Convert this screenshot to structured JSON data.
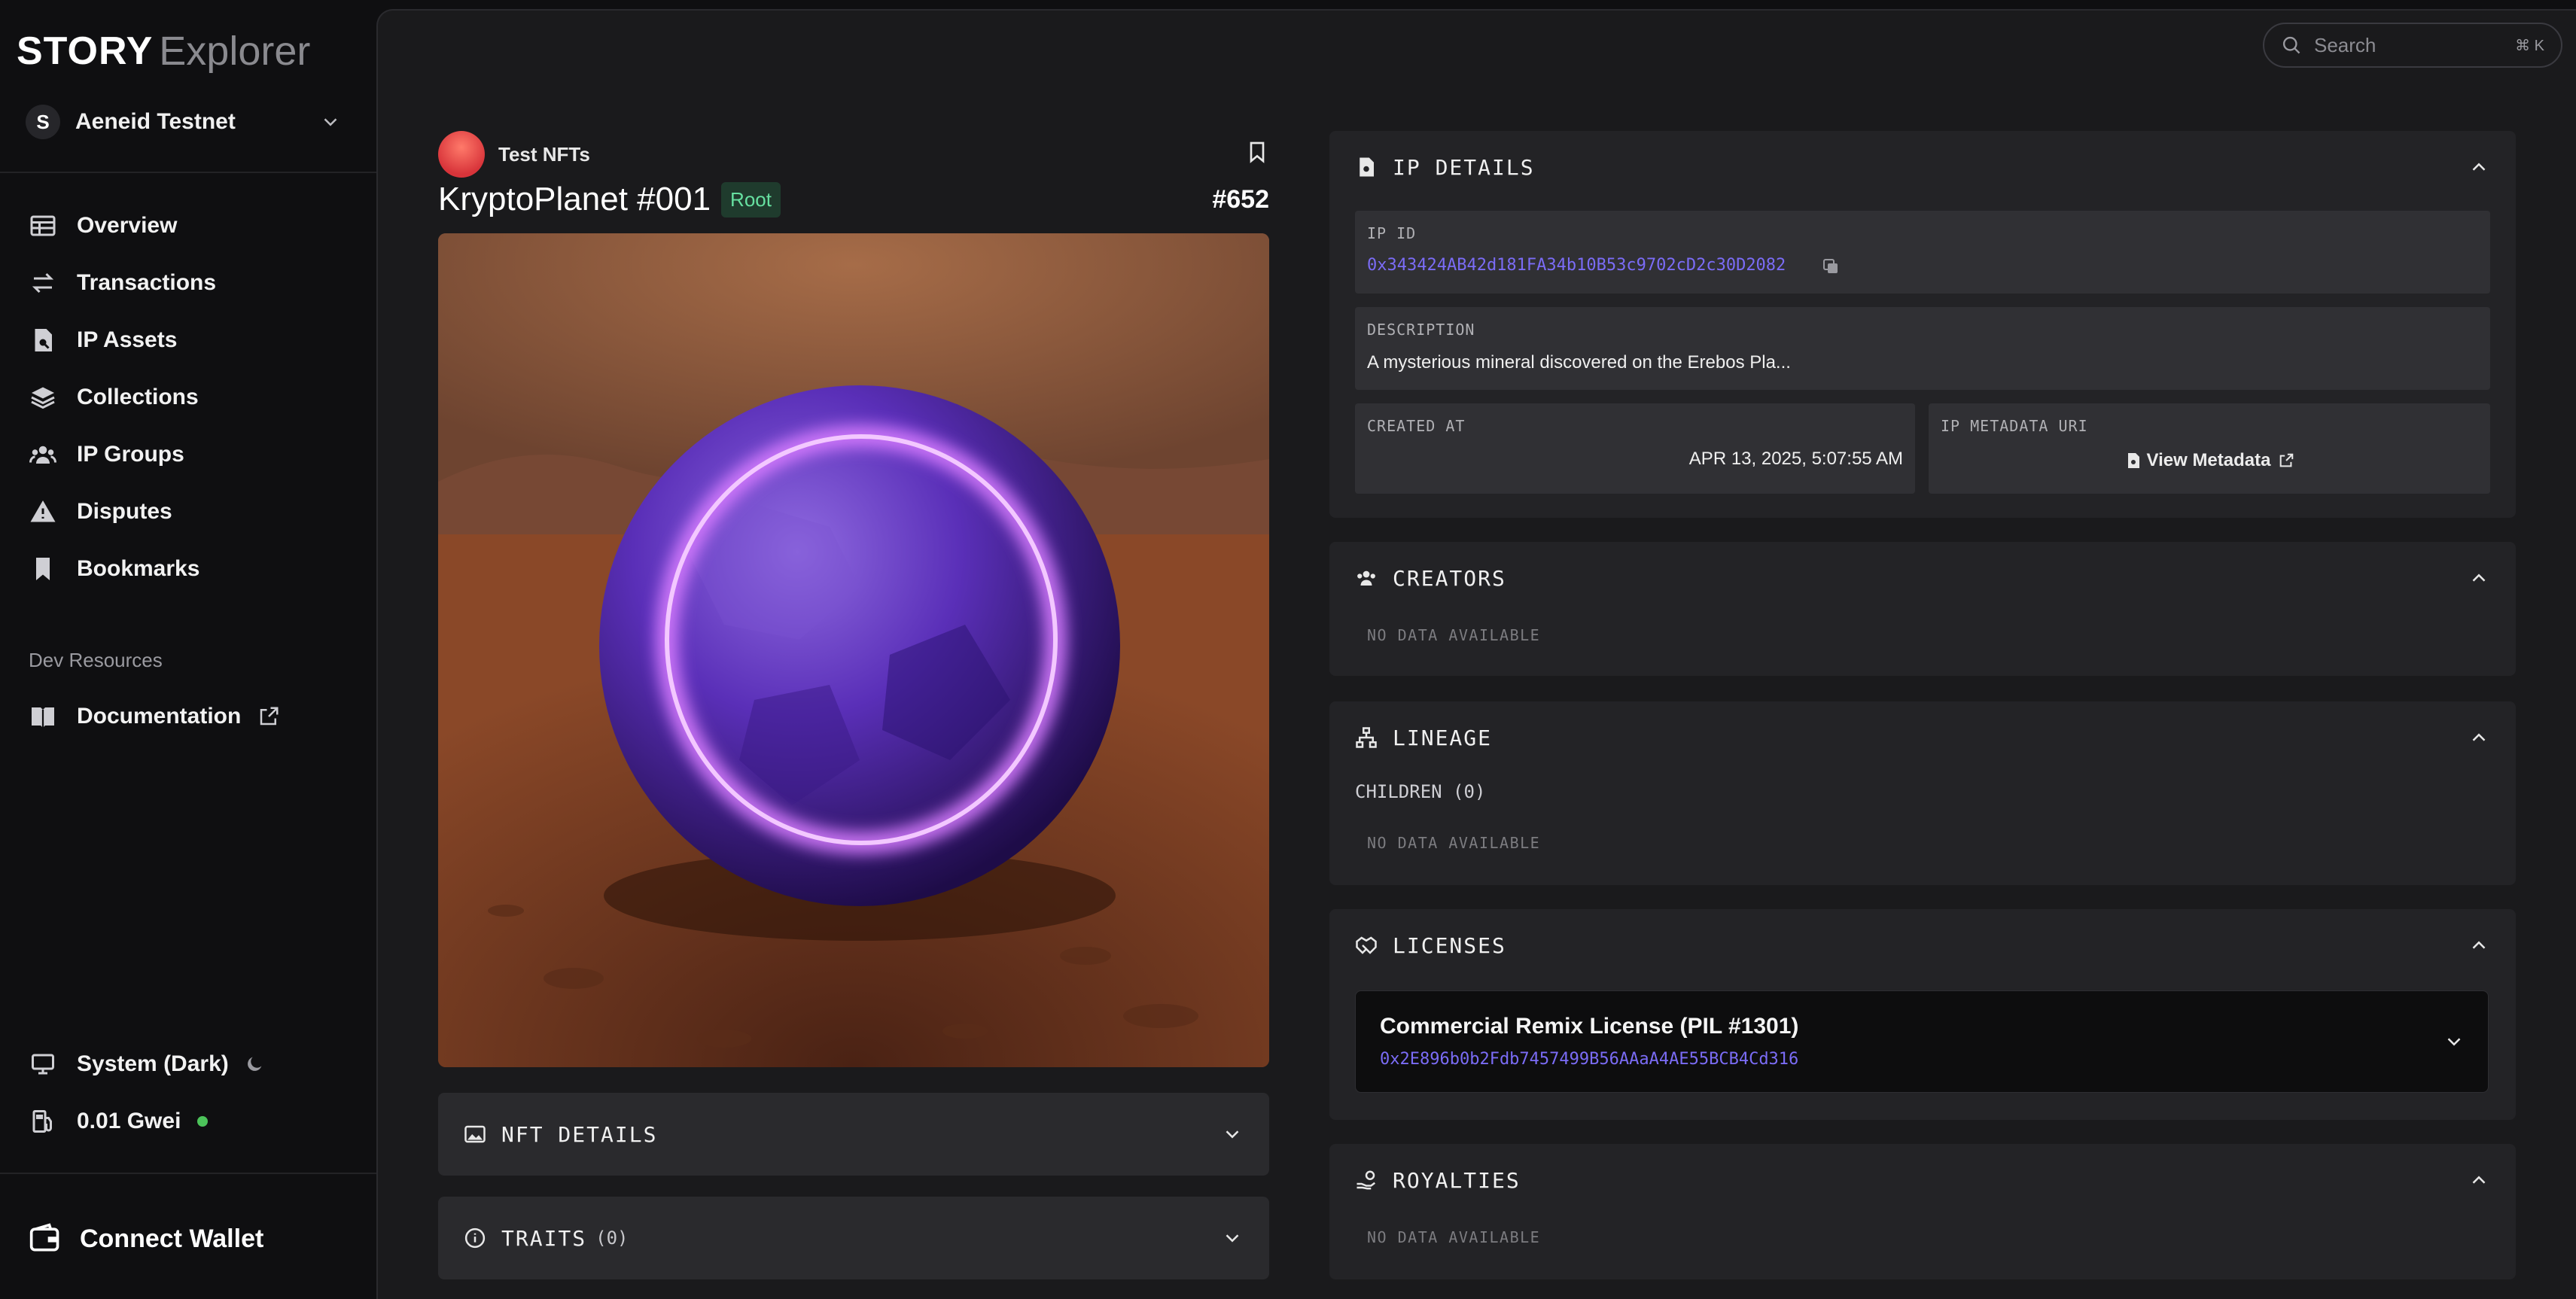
{
  "app": {
    "brand": "STORY",
    "product": "Explorer"
  },
  "network": {
    "badge": "S",
    "name": "Aeneid Testnet"
  },
  "sidebar": {
    "items": [
      {
        "label": "Overview",
        "icon": "table-icon"
      },
      {
        "label": "Transactions",
        "icon": "arrows-icon"
      },
      {
        "label": "IP Assets",
        "icon": "file-search-icon"
      },
      {
        "label": "Collections",
        "icon": "layers-icon"
      },
      {
        "label": "IP Groups",
        "icon": "users-icon"
      },
      {
        "label": "Disputes",
        "icon": "warning-icon"
      },
      {
        "label": "Bookmarks",
        "icon": "bookmark-icon"
      }
    ],
    "dev_section": "Dev Resources",
    "documentation": "Documentation",
    "theme": "System (Dark)",
    "gas": "0.01 Gwei",
    "connect_wallet": "Connect Wallet"
  },
  "search": {
    "placeholder": "Search",
    "shortcut": "⌘ K"
  },
  "asset": {
    "collection": "Test NFTs",
    "title": "KryptoPlanet #001",
    "badge": "Root",
    "token_number": "#652"
  },
  "left_sections": {
    "nft_details": "NFT DETAILS",
    "traits": "TRAITS",
    "traits_count": "(0)"
  },
  "ip_details": {
    "heading": "IP DETAILS",
    "ip_id_label": "IP ID",
    "ip_id": "0x343424AB42d181FA34b10B53c9702cD2c30D2082",
    "description_label": "DESCRIPTION",
    "description": "A mysterious mineral discovered on the Erebos Pla...",
    "created_label": "CREATED AT",
    "created": "APR 13, 2025, 5:07:55 AM",
    "metadata_label": "IP METADATA URI",
    "metadata_link": "View Metadata"
  },
  "creators": {
    "heading": "CREATORS",
    "empty": "NO DATA AVAILABLE"
  },
  "lineage": {
    "heading": "LINEAGE",
    "children": "CHILDREN (0)",
    "empty": "NO DATA AVAILABLE"
  },
  "licenses": {
    "heading": "LICENSES",
    "name": "Commercial Remix License (PIL #1301)",
    "address": "0x2E896b0b2Fdb7457499B56AAaA4AE55BCB4Cd316"
  },
  "royalties": {
    "heading": "ROYALTIES",
    "empty": "NO DATA AVAILABLE"
  },
  "colors": {
    "link": "#7b6cf6",
    "accent_green": "#66e0a0",
    "status_green": "#4cc35a"
  }
}
